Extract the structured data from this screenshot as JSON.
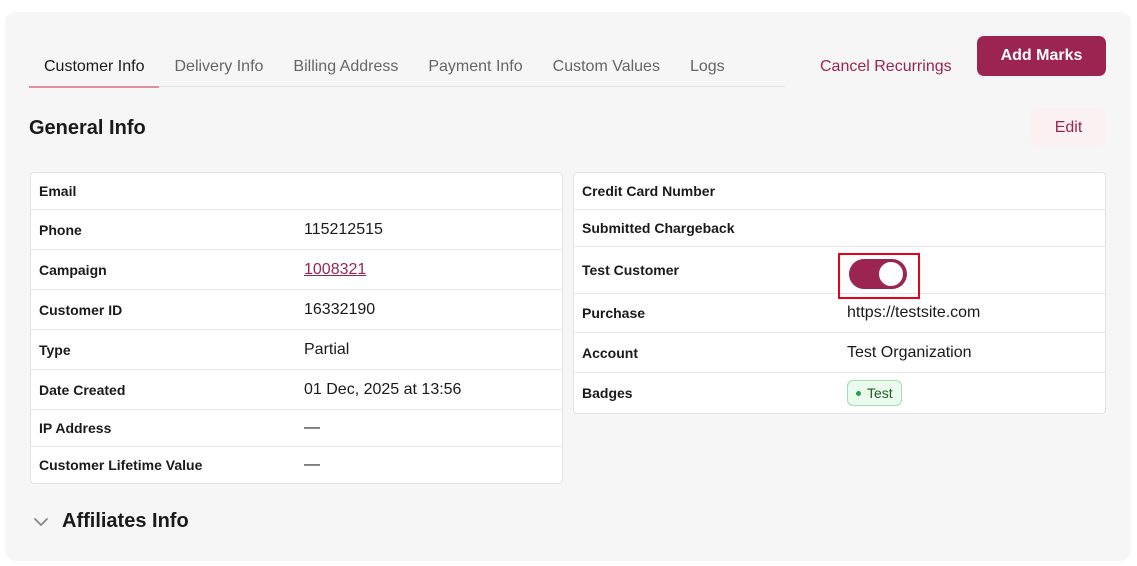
{
  "tabs": [
    {
      "label": "Customer Info",
      "active": true
    },
    {
      "label": "Delivery Info"
    },
    {
      "label": "Billing Address"
    },
    {
      "label": "Payment Info"
    },
    {
      "label": "Custom Values"
    },
    {
      "label": "Logs"
    }
  ],
  "actions": {
    "cancel_recurrings": "Cancel Recurrings",
    "add_marks": "Add Marks",
    "edit": "Edit"
  },
  "section": {
    "title": "General Info",
    "affiliates_title": "Affiliates Info"
  },
  "left_rows": [
    {
      "label": "Email",
      "value": ""
    },
    {
      "label": "Phone",
      "value": "115212515"
    },
    {
      "label": "Campaign",
      "value": "1008321"
    },
    {
      "label": "Customer ID",
      "value": "16332190"
    },
    {
      "label": "Type",
      "value": "Partial"
    },
    {
      "label": "Date Created",
      "value": "01 Dec, 2025 at 13:56"
    },
    {
      "label": "IP Address",
      "value": "—"
    },
    {
      "label": "Customer Lifetime Value",
      "value": "—"
    }
  ],
  "right_rows": [
    {
      "label": "Credit Card Number",
      "value": ""
    },
    {
      "label": "Submitted Chargeback",
      "value": ""
    },
    {
      "label": "Test Customer",
      "toggle_on": true
    },
    {
      "label": "Purchase",
      "value": "https://testsite.com"
    },
    {
      "label": "Account",
      "value": "Test Organization"
    },
    {
      "label": "Badges",
      "badge": "Test"
    }
  ],
  "colors": {
    "accent": "#9b2550",
    "highlight": "#e8001c",
    "badge_dot": "#22a54a"
  },
  "icons": {
    "affiliates_toggle": "chevron-down-icon"
  }
}
